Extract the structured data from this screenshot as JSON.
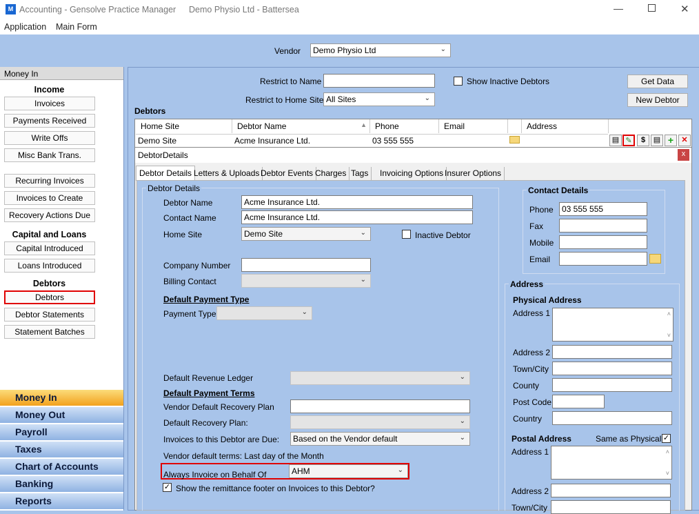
{
  "window": {
    "app_title": "Accounting - Gensolve Practice Manager",
    "practice_title": "Demo Physio Ltd - Battersea"
  },
  "menu": {
    "application": "Application",
    "main_form": "Main Form"
  },
  "vendor": {
    "label": "Vendor",
    "value": "Demo Physio Ltd"
  },
  "sidebar": {
    "header": "Money In",
    "income_heading": "Income",
    "income_items": [
      "Invoices",
      "Payments Received",
      "Write Offs",
      "Misc Bank Trans."
    ],
    "recurring_items": [
      "Recurring Invoices",
      "Invoices to Create",
      "Recovery Actions Due"
    ],
    "capital_heading": "Capital and Loans",
    "capital_items": [
      "Capital Introduced",
      "Loans Introduced"
    ],
    "debtors_heading": "Debtors",
    "debtors_items": [
      "Debtors",
      "Debtor Statements",
      "Statement Batches"
    ],
    "nav": [
      "Money In",
      "Money Out",
      "Payroll",
      "Taxes",
      "Chart of Accounts",
      "Banking",
      "Reports"
    ]
  },
  "filters": {
    "restrict_name_label": "Restrict to Name",
    "restrict_name_value": "",
    "restrict_site_label": "Restrict to Home Site",
    "restrict_site_value": "All Sites",
    "show_inactive_label": "Show Inactive Debtors",
    "get_data": "Get Data",
    "new_debtor": "New Debtor"
  },
  "grid": {
    "title": "Debtors",
    "columns": [
      "Home Site",
      "Debtor Name",
      "Phone",
      "Email",
      "Address"
    ],
    "row": {
      "home_site": "Demo Site",
      "debtor_name": "Acme Insurance Ltd.",
      "phone": "03 555 555",
      "email": "",
      "address": ""
    }
  },
  "dialog": {
    "title": "DebtorDetails",
    "close": "x",
    "tabs": [
      "Debtor Details",
      "Letters & Uploads",
      "Debtor Events",
      "Charges",
      "Tags",
      "Invoicing Options",
      "Insurer Options"
    ],
    "group_title": "Debtor Details",
    "debtor_name_label": "Debtor Name",
    "debtor_name": "Acme Insurance Ltd.",
    "contact_name_label": "Contact Name",
    "contact_name": "Acme Insurance Ltd.",
    "home_site_label": "Home Site",
    "home_site": "Demo Site",
    "inactive_label": "Inactive Debtor",
    "company_number_label": "Company Number",
    "company_number": "",
    "billing_contact_label": "Billing Contact",
    "default_payment_type_heading": "Default Payment Type",
    "payment_type_label": "Payment Type",
    "revenue_ledger_label": "Default Revenue Ledger",
    "default_payment_terms_heading": "Default Payment Terms",
    "vendor_recovery_plan_label": "Vendor Default Recovery Plan",
    "recovery_plan_label": "Default Recovery Plan:",
    "due_label": "Invoices to this Debtor are Due:",
    "due_value": "Based on the Vendor default",
    "vendor_terms": "Vendor default terms: Last day of the Month",
    "always_invoice_label": "Always Invoice on Behalf Of",
    "always_invoice_value": "AHM",
    "remittance_label": "Show the remittance footer on Invoices to this Debtor?",
    "contact_heading": "Contact Details",
    "phone_label": "Phone",
    "phone": "03 555 555",
    "fax_label": "Fax",
    "mobile_label": "Mobile",
    "email_label": "Email",
    "address_heading": "Address",
    "physical_heading": "Physical Address",
    "address1_label": "Address 1",
    "address2_label": "Address 2",
    "town_label": "Town/City",
    "county_label": "County",
    "postcode_label": "Post Code",
    "country_label": "Country",
    "postal_heading": "Postal Address",
    "same_as_physical": "Same as Physical?",
    "postal_address1_label": "Address 1",
    "postal_address2_label": "Address 2",
    "postal_town_label": "Town/City"
  },
  "colors": {
    "panel": "#a8c4ea",
    "highlight": "#e00000",
    "nav_active": "#f2a11d"
  }
}
